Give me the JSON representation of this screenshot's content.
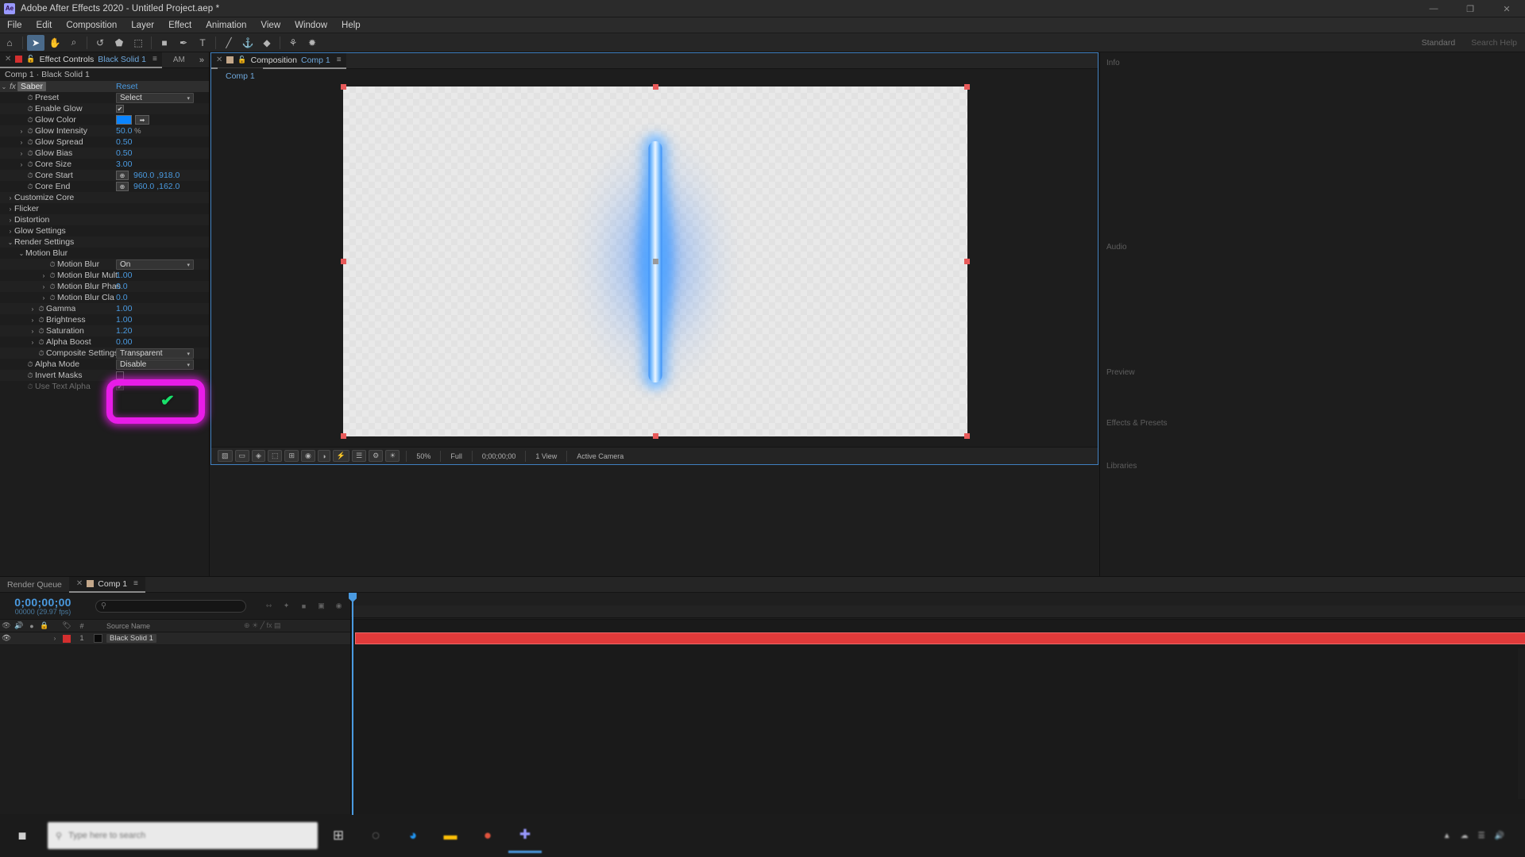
{
  "titlebar": {
    "app_icon": "after-effects-logo",
    "title": "Adobe After Effects 2020 - Untitled Project.aep *",
    "minimize": "—",
    "maximize": "❐",
    "close": "✕"
  },
  "menubar": {
    "items": [
      "File",
      "Edit",
      "Composition",
      "Layer",
      "Effect",
      "Animation",
      "View",
      "Window",
      "Help"
    ]
  },
  "toolbar": {
    "tools": [
      {
        "name": "home-icon",
        "glyph": "⌂"
      },
      {
        "name": "selection-tool-icon",
        "glyph": "➤"
      },
      {
        "name": "hand-tool-icon",
        "glyph": "✋"
      },
      {
        "name": "zoom-tool-icon",
        "glyph": "⌕"
      },
      {
        "name": "rotation-tool-icon",
        "glyph": "↺"
      },
      {
        "name": "camera-tool-icon",
        "glyph": "⬟"
      },
      {
        "name": "anchor-point-tool-icon",
        "glyph": "⬚"
      },
      {
        "name": "shape-tool-icon",
        "glyph": "■"
      },
      {
        "name": "pen-tool-icon",
        "glyph": "✒"
      },
      {
        "name": "type-tool-icon",
        "glyph": "T"
      },
      {
        "name": "brush-tool-icon",
        "glyph": "╱"
      },
      {
        "name": "clone-stamp-tool-icon",
        "glyph": "⚓"
      },
      {
        "name": "eraser-tool-icon",
        "glyph": "◆"
      },
      {
        "name": "roto-brush-tool-icon",
        "glyph": "⚘"
      },
      {
        "name": "puppet-tool-icon",
        "glyph": "✹"
      }
    ],
    "workspace_label": "Standard",
    "search_help_label": "Search Help"
  },
  "effect_controls": {
    "tab_label": "Effect Controls",
    "tab_target": "Black Solid 1",
    "close_glyph": "✕",
    "lock_glyph": "🔓",
    "menu_glyph": "≡",
    "am_label": "AM",
    "more_glyph": "»",
    "breadcrumb": "Comp 1 · Black Solid 1",
    "effect_name": "Saber",
    "reset_label": "Reset",
    "fx_glyph": "fx",
    "parameters": [
      {
        "name": "Preset",
        "indent": 1,
        "control": "dropdown",
        "value": "Select",
        "arrow": "",
        "stopwatch": true
      },
      {
        "name": "Enable Glow",
        "indent": 1,
        "control": "checkbox",
        "value": "on",
        "arrow": "",
        "stopwatch": true
      },
      {
        "name": "Glow Color",
        "indent": 1,
        "control": "color",
        "value": "#0a84ff",
        "arrow": "",
        "stopwatch": true
      },
      {
        "name": "Glow Intensity",
        "indent": 1,
        "control": "number",
        "value": "50.0",
        "unit": "%",
        "arrow": "›",
        "stopwatch": true
      },
      {
        "name": "Glow Spread",
        "indent": 1,
        "control": "number",
        "value": "0.50",
        "arrow": "›",
        "stopwatch": true
      },
      {
        "name": "Glow Bias",
        "indent": 1,
        "control": "number",
        "value": "0.50",
        "arrow": "›",
        "stopwatch": true
      },
      {
        "name": "Core Size",
        "indent": 1,
        "control": "number",
        "value": "3.00",
        "arrow": "›",
        "stopwatch": true
      },
      {
        "name": "Core Start",
        "indent": 1,
        "control": "point",
        "value": "960.0 ,918.0",
        "arrow": "",
        "stopwatch": true
      },
      {
        "name": "Core End",
        "indent": 1,
        "control": "point",
        "value": "960.0 ,162.0",
        "arrow": "",
        "stopwatch": true
      },
      {
        "name": "Customize Core",
        "indent": 0,
        "control": "group",
        "value": "",
        "arrow": "›",
        "stopwatch": false
      },
      {
        "name": "Flicker",
        "indent": 0,
        "control": "group",
        "value": "",
        "arrow": "›",
        "stopwatch": false
      },
      {
        "name": "Distortion",
        "indent": 0,
        "control": "group",
        "value": "",
        "arrow": "›",
        "stopwatch": false
      },
      {
        "name": "Glow Settings",
        "indent": 0,
        "control": "group",
        "value": "",
        "arrow": "›",
        "stopwatch": false
      },
      {
        "name": "Render Settings",
        "indent": 0,
        "control": "group",
        "value": "",
        "arrow": "⌄",
        "stopwatch": false
      },
      {
        "name": "Motion Blur",
        "indent": 1,
        "control": "group",
        "value": "",
        "arrow": "⌄",
        "stopwatch": false
      },
      {
        "name": "Motion Blur",
        "indent": 3,
        "control": "dropdown",
        "value": "On",
        "arrow": "",
        "stopwatch": true
      },
      {
        "name": "Motion Blur Mult",
        "indent": 3,
        "control": "number",
        "value": "1.00",
        "arrow": "›",
        "stopwatch": true
      },
      {
        "name": "Motion Blur Phas",
        "indent": 3,
        "control": "number",
        "value": "0.0",
        "arrow": "›",
        "stopwatch": true
      },
      {
        "name": "Motion Blur Cla",
        "indent": 3,
        "control": "number",
        "value": "0.0",
        "arrow": "›",
        "stopwatch": true
      },
      {
        "name": "Gamma",
        "indent": 2,
        "control": "number",
        "value": "1.00",
        "arrow": "›",
        "stopwatch": true
      },
      {
        "name": "Brightness",
        "indent": 2,
        "control": "number",
        "value": "1.00",
        "arrow": "›",
        "stopwatch": true
      },
      {
        "name": "Saturation",
        "indent": 2,
        "control": "number",
        "value": "1.20",
        "arrow": "›",
        "stopwatch": true
      },
      {
        "name": "Alpha Boost",
        "indent": 2,
        "control": "number",
        "value": "0.00",
        "arrow": "›",
        "stopwatch": true
      },
      {
        "name": "Composite Settings",
        "indent": 2,
        "control": "dropdown",
        "value": "Transparent",
        "arrow": "",
        "stopwatch": true
      },
      {
        "name": "Alpha Mode",
        "indent": 1,
        "control": "dropdown",
        "value": "Disable",
        "arrow": "",
        "stopwatch": true
      },
      {
        "name": "Invert Masks",
        "indent": 1,
        "control": "checkbox",
        "value": "off",
        "arrow": "",
        "stopwatch": true
      },
      {
        "name": "Use Text Alpha",
        "indent": 1,
        "control": "checkbox",
        "value": "on",
        "disabled": true,
        "arrow": "",
        "stopwatch": true
      }
    ],
    "annotation": {
      "highlight_color": "#e81ce8",
      "check_glyph": "✔",
      "check_color": "#18e06a"
    }
  },
  "composition": {
    "tab_label": "Composition",
    "tab_comp_name": "Comp 1",
    "close_glyph": "✕",
    "menu_glyph": "≡",
    "subtab_label": "Comp 1",
    "bottom_bar": {
      "magnification": "50%",
      "resolution": "Full",
      "view_label": "1 View",
      "quality_label": "Active Camera",
      "timecode": "0;00;00;00",
      "buttons": [
        {
          "name": "toggle-transparency-grid-icon",
          "glyph": "▧"
        },
        {
          "name": "toggle-mask-paths-icon",
          "glyph": "▭"
        },
        {
          "name": "toggle-3d-view-icon",
          "glyph": "◈"
        },
        {
          "name": "region-of-interest-icon",
          "glyph": "⬚"
        },
        {
          "name": "grid-guides-icon",
          "glyph": "⊞"
        },
        {
          "name": "snapshot-icon",
          "glyph": "◉"
        },
        {
          "name": "channel-icon",
          "glyph": "◑"
        },
        {
          "name": "fast-previews-icon",
          "glyph": "⚡"
        },
        {
          "name": "timeline-icon",
          "glyph": "☰"
        },
        {
          "name": "comp-flowchart-icon",
          "glyph": "⚙"
        },
        {
          "name": "reset-exposure-icon",
          "glyph": "☀"
        }
      ]
    },
    "canvas": {
      "glow_color": "#4a9cff",
      "core_color": "#eaf5ff",
      "background": "transparent-checkerboard"
    }
  },
  "right_dock": {
    "panel_labels": [
      "Info",
      "Audio",
      "Preview",
      "Effects & Presets",
      "Libraries"
    ]
  },
  "timeline": {
    "tabs": [
      {
        "label": "Render Queue",
        "selected": false
      },
      {
        "label": "Comp 1",
        "selected": true
      }
    ],
    "close_glyph": "✕",
    "menu_glyph": "≡",
    "current_time": "0;00;00;00",
    "frame_info": "00000 (29.97 fps)",
    "search_placeholder": "",
    "search_icon": "search-icon",
    "columns": [
      "Source Name"
    ],
    "col_toggles": [
      "👁",
      "🔊",
      "●",
      "🔒"
    ],
    "layers": [
      {
        "index": "1",
        "name": "Black Solid 1",
        "color": "#d32f2f",
        "visible": true
      }
    ],
    "switches_header": "⊕ ☀ ╱ fx ▤"
  },
  "taskbar": {
    "start_icon": "windows-start-icon",
    "search_placeholder": "Type here to search",
    "search_icon": "search-icon",
    "pinned": [
      {
        "name": "task-view-icon",
        "glyph": "⊞",
        "color": "#c8c8c8"
      },
      {
        "name": "cortana-icon",
        "glyph": "◌",
        "color": "#9a9a9a"
      },
      {
        "name": "edge-browser-icon",
        "glyph": "◕",
        "color": "#2196f3"
      },
      {
        "name": "file-explorer-icon",
        "glyph": "▬",
        "color": "#ffc107"
      },
      {
        "name": "chrome-icon",
        "glyph": "●",
        "color": "#e0533d"
      },
      {
        "name": "after-effects-icon",
        "glyph": "✚",
        "color": "#9999ff",
        "active": true
      }
    ],
    "tray_items": [
      "▲",
      "☁",
      "🔊",
      "📶"
    ],
    "clock": ""
  }
}
